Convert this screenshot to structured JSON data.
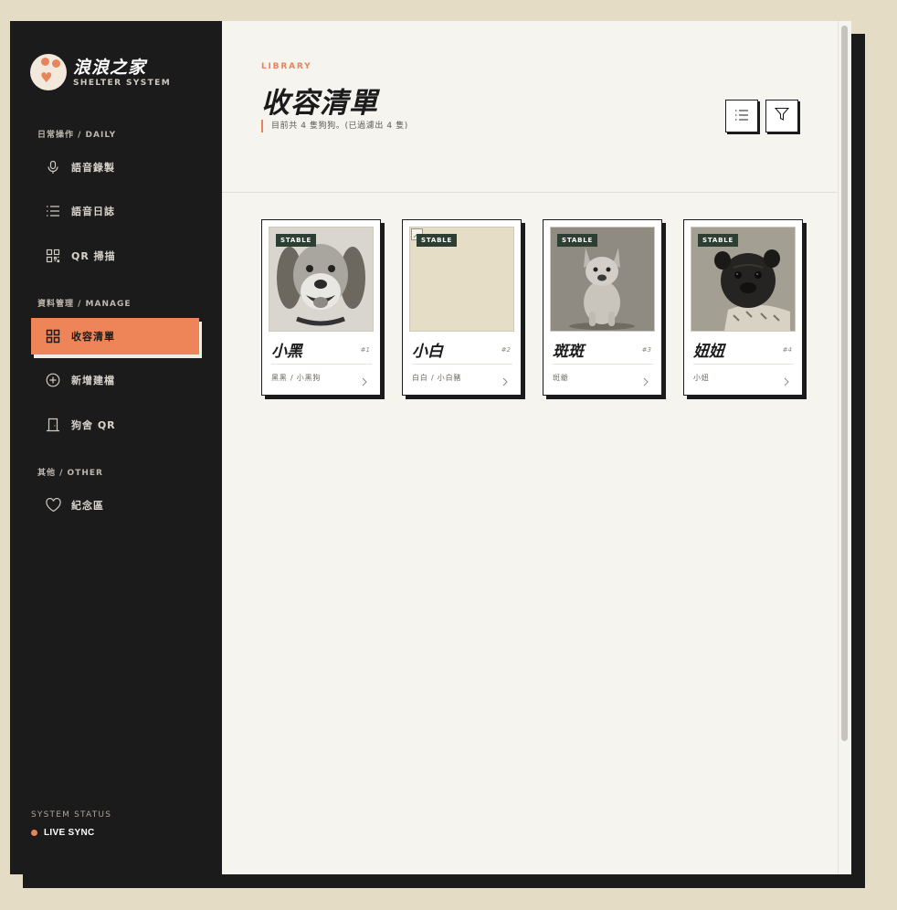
{
  "brand": {
    "title": "浪浪之家",
    "subtitle": "SHELTER SYSTEM"
  },
  "sidebar": {
    "sections": [
      {
        "label": "日常操作 / DAILY",
        "items": [
          {
            "label": "語音錄製",
            "icon": "microphone-icon"
          },
          {
            "label": "語音日誌",
            "icon": "list-icon"
          },
          {
            "label": "QR 掃描",
            "icon": "qr-scan-icon"
          }
        ]
      },
      {
        "label": "資料管理 / MANAGE",
        "items": [
          {
            "label": "收容清單",
            "icon": "grid-icon",
            "active": true
          },
          {
            "label": "新增建檔",
            "icon": "plus-circle-icon"
          },
          {
            "label": "狗舍 QR",
            "icon": "kennel-door-icon"
          }
        ]
      },
      {
        "label": "其他 / OTHER",
        "items": [
          {
            "label": "紀念區",
            "icon": "heart-icon"
          }
        ]
      }
    ],
    "status_label": "SYSTEM STATUS",
    "status_value": "LIVE SYNC"
  },
  "header": {
    "eyebrow": "LIBRARY",
    "title": "收容清單",
    "subtitle": "目前共 4 隻狗狗。(已過濾出 4 隻)"
  },
  "toolbar": {
    "list_icon": "list-view-icon",
    "filter_icon": "filter-icon"
  },
  "dogs": [
    {
      "name": "小黑",
      "number": "#1",
      "alias": "黑黑 / 小黑狗",
      "status": "STABLE",
      "photo": "beagle-photo"
    },
    {
      "name": "小白",
      "number": "#2",
      "alias": "白白 / 小白豬",
      "status": "STABLE",
      "photo": "broken-image"
    },
    {
      "name": "斑斑",
      "number": "#3",
      "alias": "斑爺",
      "status": "STABLE",
      "photo": "french-bulldog-photo"
    },
    {
      "name": "妞妞",
      "number": "#4",
      "alias": "小妞",
      "status": "STABLE",
      "photo": "pug-photo"
    }
  ],
  "colors": {
    "accent": "#ee8559",
    "sidebar": "#1b1b1b",
    "badge": "#2d3f33",
    "background": "#e5dcc6"
  }
}
